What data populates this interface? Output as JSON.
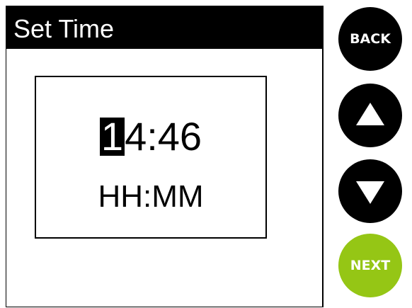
{
  "screen": {
    "title": "Set Time",
    "time": {
      "cursor_digit": "1",
      "rest": "4:46",
      "format": "HH:MM"
    }
  },
  "buttons": {
    "back_label": "BACK",
    "up_icon": "arrow-up-icon",
    "down_icon": "arrow-down-icon",
    "next_label": "NEXT"
  },
  "colors": {
    "accent_next": "#95c615",
    "button_bg": "#000000"
  }
}
